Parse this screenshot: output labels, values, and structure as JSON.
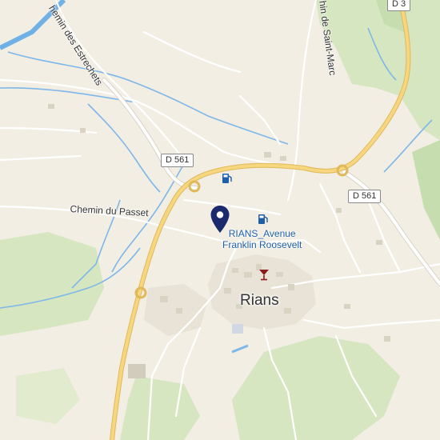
{
  "map": {
    "town": "Rians",
    "location_marker": {
      "label_line1": "RIANS_Avenue",
      "label_line2": "Franklin Roosevelt",
      "icon": "location-pin-icon",
      "color": "#1a2a6c"
    },
    "roads": [
      {
        "id": "d3",
        "label": "D 3"
      },
      {
        "id": "d561_west",
        "label": "D 561"
      },
      {
        "id": "d561_east",
        "label": "D 561"
      },
      {
        "id": "chemin_passet",
        "label": "Chemin du Passet"
      },
      {
        "id": "chemin_estrechets",
        "label": "hemin des Estrechets"
      },
      {
        "id": "chemin_saint_marc",
        "label": "hin de Saint-Marc"
      }
    ],
    "pois": [
      {
        "type": "fuel-station-icon",
        "color": "#1f5fa8"
      },
      {
        "type": "fuel-station-icon",
        "color": "#1f5fa8"
      },
      {
        "type": "bar-icon",
        "color": "#8b1a1a"
      }
    ],
    "colors": {
      "land": "#f2eee3",
      "park": "#cfe3b8",
      "water": "#6fb0e6",
      "major_road": "#f4d27a",
      "minor_road": "#ffffff"
    }
  }
}
